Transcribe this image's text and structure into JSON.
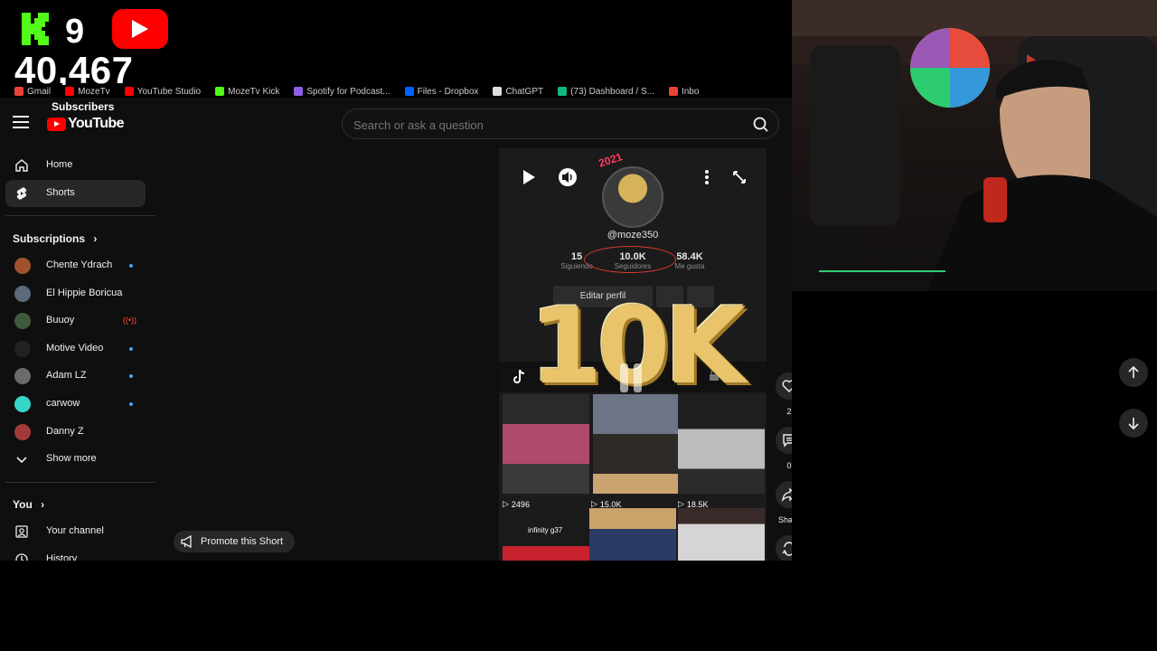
{
  "overlay": {
    "kick_count": "9",
    "subscriber_count": "40,467",
    "subscriber_label": "Subscribers"
  },
  "bookmarks": [
    {
      "label": "Gmail",
      "color": "#ea4335"
    },
    {
      "label": "MozeTv",
      "color": "#ff0000"
    },
    {
      "label": "YouTube Studio",
      "color": "#ff0000"
    },
    {
      "label": "MozeTv Kick",
      "color": "#53fc18"
    },
    {
      "label": "Spotify for Podcast...",
      "color": "#8e60e6"
    },
    {
      "label": "Files - Dropbox",
      "color": "#0061fe"
    },
    {
      "label": "ChatGPT",
      "color": "#e0e0e0"
    },
    {
      "label": "(73) Dashboard / S...",
      "color": "#10b981"
    },
    {
      "label": "Inbo",
      "color": "#ea4335"
    }
  ],
  "header": {
    "brand": "YouTube",
    "search_placeholder": "Search or ask a question"
  },
  "sidebar": {
    "nav": [
      {
        "label": "Home"
      },
      {
        "label": "Shorts"
      }
    ],
    "subscriptions_heading": "Subscriptions",
    "subscriptions": [
      {
        "label": "Chente Ydrach",
        "badge": "dot",
        "avatar_color": "#a0522d"
      },
      {
        "label": "El Hippie Boricua",
        "badge": "",
        "avatar_color": "#5a6a7a"
      },
      {
        "label": "Buuoy",
        "badge": "live",
        "avatar_color": "#3d5a3d"
      },
      {
        "label": "Motive Video",
        "badge": "dot",
        "avatar_color": "#222222"
      },
      {
        "label": "Adam LZ",
        "badge": "dot",
        "avatar_color": "#6b6b6b"
      },
      {
        "label": "carwow",
        "badge": "dot",
        "avatar_color": "#36d6c7"
      },
      {
        "label": "Danny Z",
        "badge": "",
        "avatar_color": "#a33a3a"
      }
    ],
    "show_more": "Show more",
    "you_heading": "You",
    "you_items": [
      {
        "label": "Your channel"
      },
      {
        "label": "History"
      }
    ]
  },
  "promote_label": "Promote this Short",
  "short": {
    "profile_year": "2021",
    "handle": "@moze350",
    "stats": [
      {
        "value": "15",
        "label": "Siguiendo"
      },
      {
        "value": "10.0K",
        "label": "Seguidores"
      },
      {
        "value": "58.4K",
        "label": "Me gusta"
      }
    ],
    "edit_profile": "Editar perfil",
    "balloon_text": "10K",
    "grid_views": [
      "2496",
      "15.0K",
      "18.5K"
    ],
    "bottom_caption": "infinity g37"
  },
  "actions": {
    "like_count": "2",
    "comment_count": "0",
    "share_label": "Share"
  }
}
